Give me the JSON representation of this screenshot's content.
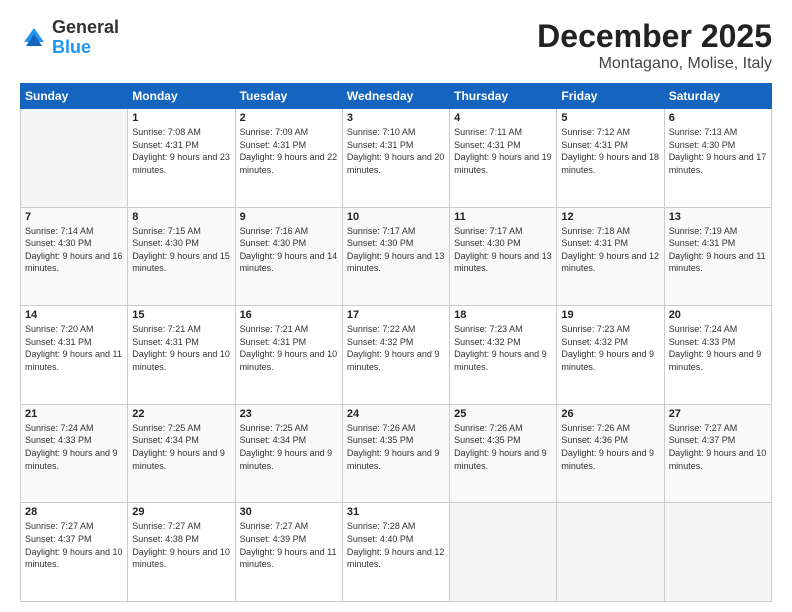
{
  "header": {
    "logo_general": "General",
    "logo_blue": "Blue",
    "title": "December 2025",
    "subtitle": "Montagano, Molise, Italy"
  },
  "days_of_week": [
    "Sunday",
    "Monday",
    "Tuesday",
    "Wednesday",
    "Thursday",
    "Friday",
    "Saturday"
  ],
  "weeks": [
    [
      {
        "day": "",
        "info": ""
      },
      {
        "day": "1",
        "info": "Sunrise: 7:08 AM\nSunset: 4:31 PM\nDaylight: 9 hours\nand 23 minutes."
      },
      {
        "day": "2",
        "info": "Sunrise: 7:09 AM\nSunset: 4:31 PM\nDaylight: 9 hours\nand 22 minutes."
      },
      {
        "day": "3",
        "info": "Sunrise: 7:10 AM\nSunset: 4:31 PM\nDaylight: 9 hours\nand 20 minutes."
      },
      {
        "day": "4",
        "info": "Sunrise: 7:11 AM\nSunset: 4:31 PM\nDaylight: 9 hours\nand 19 minutes."
      },
      {
        "day": "5",
        "info": "Sunrise: 7:12 AM\nSunset: 4:31 PM\nDaylight: 9 hours\nand 18 minutes."
      },
      {
        "day": "6",
        "info": "Sunrise: 7:13 AM\nSunset: 4:30 PM\nDaylight: 9 hours\nand 17 minutes."
      }
    ],
    [
      {
        "day": "7",
        "info": "Sunrise: 7:14 AM\nSunset: 4:30 PM\nDaylight: 9 hours\nand 16 minutes."
      },
      {
        "day": "8",
        "info": "Sunrise: 7:15 AM\nSunset: 4:30 PM\nDaylight: 9 hours\nand 15 minutes."
      },
      {
        "day": "9",
        "info": "Sunrise: 7:16 AM\nSunset: 4:30 PM\nDaylight: 9 hours\nand 14 minutes."
      },
      {
        "day": "10",
        "info": "Sunrise: 7:17 AM\nSunset: 4:30 PM\nDaylight: 9 hours\nand 13 minutes."
      },
      {
        "day": "11",
        "info": "Sunrise: 7:17 AM\nSunset: 4:30 PM\nDaylight: 9 hours\nand 13 minutes."
      },
      {
        "day": "12",
        "info": "Sunrise: 7:18 AM\nSunset: 4:31 PM\nDaylight: 9 hours\nand 12 minutes."
      },
      {
        "day": "13",
        "info": "Sunrise: 7:19 AM\nSunset: 4:31 PM\nDaylight: 9 hours\nand 11 minutes."
      }
    ],
    [
      {
        "day": "14",
        "info": "Sunrise: 7:20 AM\nSunset: 4:31 PM\nDaylight: 9 hours\nand 11 minutes."
      },
      {
        "day": "15",
        "info": "Sunrise: 7:21 AM\nSunset: 4:31 PM\nDaylight: 9 hours\nand 10 minutes."
      },
      {
        "day": "16",
        "info": "Sunrise: 7:21 AM\nSunset: 4:31 PM\nDaylight: 9 hours\nand 10 minutes."
      },
      {
        "day": "17",
        "info": "Sunrise: 7:22 AM\nSunset: 4:32 PM\nDaylight: 9 hours\nand 9 minutes."
      },
      {
        "day": "18",
        "info": "Sunrise: 7:23 AM\nSunset: 4:32 PM\nDaylight: 9 hours\nand 9 minutes."
      },
      {
        "day": "19",
        "info": "Sunrise: 7:23 AM\nSunset: 4:32 PM\nDaylight: 9 hours\nand 9 minutes."
      },
      {
        "day": "20",
        "info": "Sunrise: 7:24 AM\nSunset: 4:33 PM\nDaylight: 9 hours\nand 9 minutes."
      }
    ],
    [
      {
        "day": "21",
        "info": "Sunrise: 7:24 AM\nSunset: 4:33 PM\nDaylight: 9 hours\nand 9 minutes."
      },
      {
        "day": "22",
        "info": "Sunrise: 7:25 AM\nSunset: 4:34 PM\nDaylight: 9 hours\nand 9 minutes."
      },
      {
        "day": "23",
        "info": "Sunrise: 7:25 AM\nSunset: 4:34 PM\nDaylight: 9 hours\nand 9 minutes."
      },
      {
        "day": "24",
        "info": "Sunrise: 7:26 AM\nSunset: 4:35 PM\nDaylight: 9 hours\nand 9 minutes."
      },
      {
        "day": "25",
        "info": "Sunrise: 7:26 AM\nSunset: 4:35 PM\nDaylight: 9 hours\nand 9 minutes."
      },
      {
        "day": "26",
        "info": "Sunrise: 7:26 AM\nSunset: 4:36 PM\nDaylight: 9 hours\nand 9 minutes."
      },
      {
        "day": "27",
        "info": "Sunrise: 7:27 AM\nSunset: 4:37 PM\nDaylight: 9 hours\nand 10 minutes."
      }
    ],
    [
      {
        "day": "28",
        "info": "Sunrise: 7:27 AM\nSunset: 4:37 PM\nDaylight: 9 hours\nand 10 minutes."
      },
      {
        "day": "29",
        "info": "Sunrise: 7:27 AM\nSunset: 4:38 PM\nDaylight: 9 hours\nand 10 minutes."
      },
      {
        "day": "30",
        "info": "Sunrise: 7:27 AM\nSunset: 4:39 PM\nDaylight: 9 hours\nand 11 minutes."
      },
      {
        "day": "31",
        "info": "Sunrise: 7:28 AM\nSunset: 4:40 PM\nDaylight: 9 hours\nand 12 minutes."
      },
      {
        "day": "",
        "info": ""
      },
      {
        "day": "",
        "info": ""
      },
      {
        "day": "",
        "info": ""
      }
    ]
  ]
}
